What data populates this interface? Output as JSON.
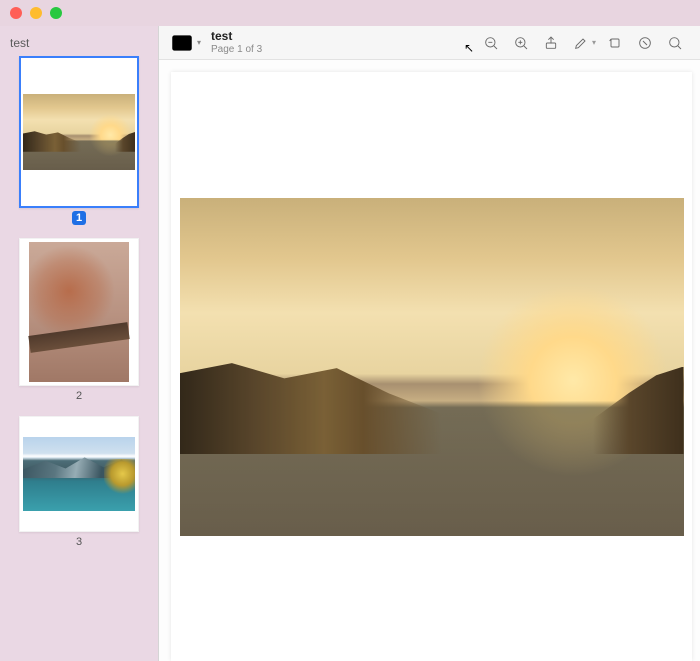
{
  "window": {
    "document_title": "test",
    "page_indicator": "Page 1 of 3"
  },
  "sidebar": {
    "title": "test",
    "thumbnails": [
      {
        "label": "1",
        "selected": true
      },
      {
        "label": "2",
        "selected": false
      },
      {
        "label": "3",
        "selected": false
      }
    ]
  },
  "toolbar_icons": {
    "sidebar_toggle": "sidebar-toggle-icon",
    "zoom_out": "zoom-out-icon",
    "zoom_in": "zoom-in-icon",
    "share": "share-icon",
    "markup": "markup-icon",
    "rotate": "rotate-icon",
    "highlight": "highlight-icon",
    "search": "search-icon"
  }
}
